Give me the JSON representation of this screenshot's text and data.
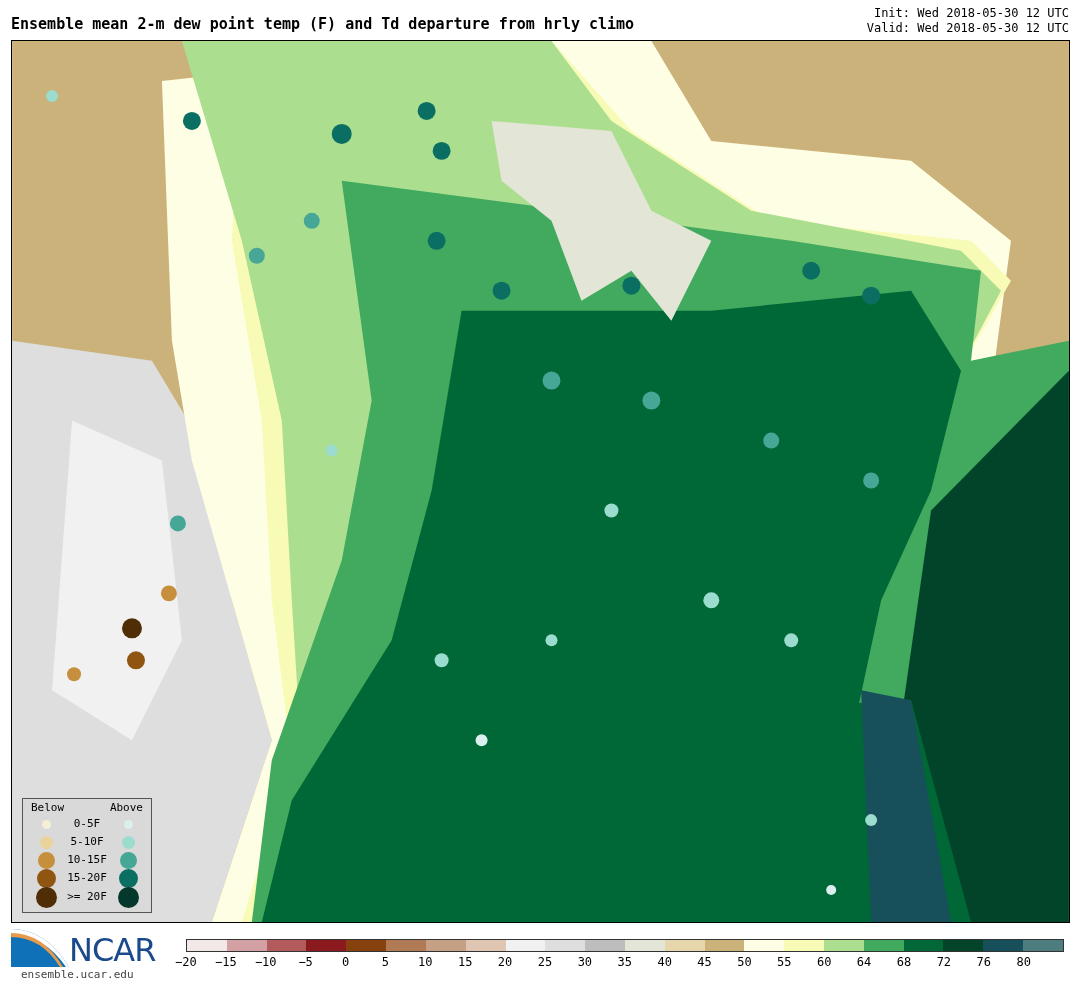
{
  "header": {
    "title": "Ensemble mean 2-m dew point temp (F) and Td departure from hrly climo",
    "init": "Init: Wed 2018-05-30 12 UTC",
    "valid": "Valid: Wed 2018-05-30 12 UTC"
  },
  "legend": {
    "below_label": "Below",
    "above_label": "Above",
    "rows": [
      {
        "label": "0-5F",
        "below": {
          "color": "#f5efd9"
        },
        "above": {
          "color": "#dcefef"
        }
      },
      {
        "label": "5-10F",
        "below": {
          "color": "#ead39a"
        },
        "above": {
          "color": "#9bdccf"
        }
      },
      {
        "label": "10-15F",
        "below": {
          "color": "#c68f3e"
        },
        "above": {
          "color": "#46a797"
        }
      },
      {
        "label": "15-20F",
        "below": {
          "color": "#8f5511"
        },
        "above": {
          "color": "#0b6e62"
        }
      },
      {
        "label": ">= 20F",
        "below": {
          "color": "#4f2d06"
        },
        "above": {
          "color": "#05382c"
        }
      }
    ]
  },
  "logo": {
    "text": "NCAR",
    "url": "ensemble.ucar.edu"
  },
  "colorbar": {
    "segments": [
      {
        "color": "#f3e8e8"
      },
      {
        "color": "#d3a0a4"
      },
      {
        "color": "#b35a5c"
      },
      {
        "color": "#8b1a1e"
      },
      {
        "color": "#86410f"
      },
      {
        "color": "#b07a55"
      },
      {
        "color": "#c6a085"
      },
      {
        "color": "#dfc6b3"
      },
      {
        "color": "#f1f1f1"
      },
      {
        "color": "#dedede"
      },
      {
        "color": "#bdbdbd"
      },
      {
        "color": "#e3e5d6"
      },
      {
        "color": "#e6d6ab"
      },
      {
        "color": "#cbb27a"
      },
      {
        "color": "#fefee4"
      },
      {
        "color": "#f7fbb6"
      },
      {
        "color": "#acde8f"
      },
      {
        "color": "#41aa5e"
      },
      {
        "color": "#006836"
      },
      {
        "color": "#014429"
      },
      {
        "color": "#17505a"
      },
      {
        "color": "#4d7d7f"
      }
    ],
    "ticks": [
      "−20",
      "−15",
      "−10",
      "−5",
      "0",
      "5",
      "10",
      "15",
      "20",
      "25",
      "30",
      "35",
      "40",
      "45",
      "50",
      "55",
      "60",
      "64",
      "68",
      "72",
      "76",
      "80"
    ]
  }
}
